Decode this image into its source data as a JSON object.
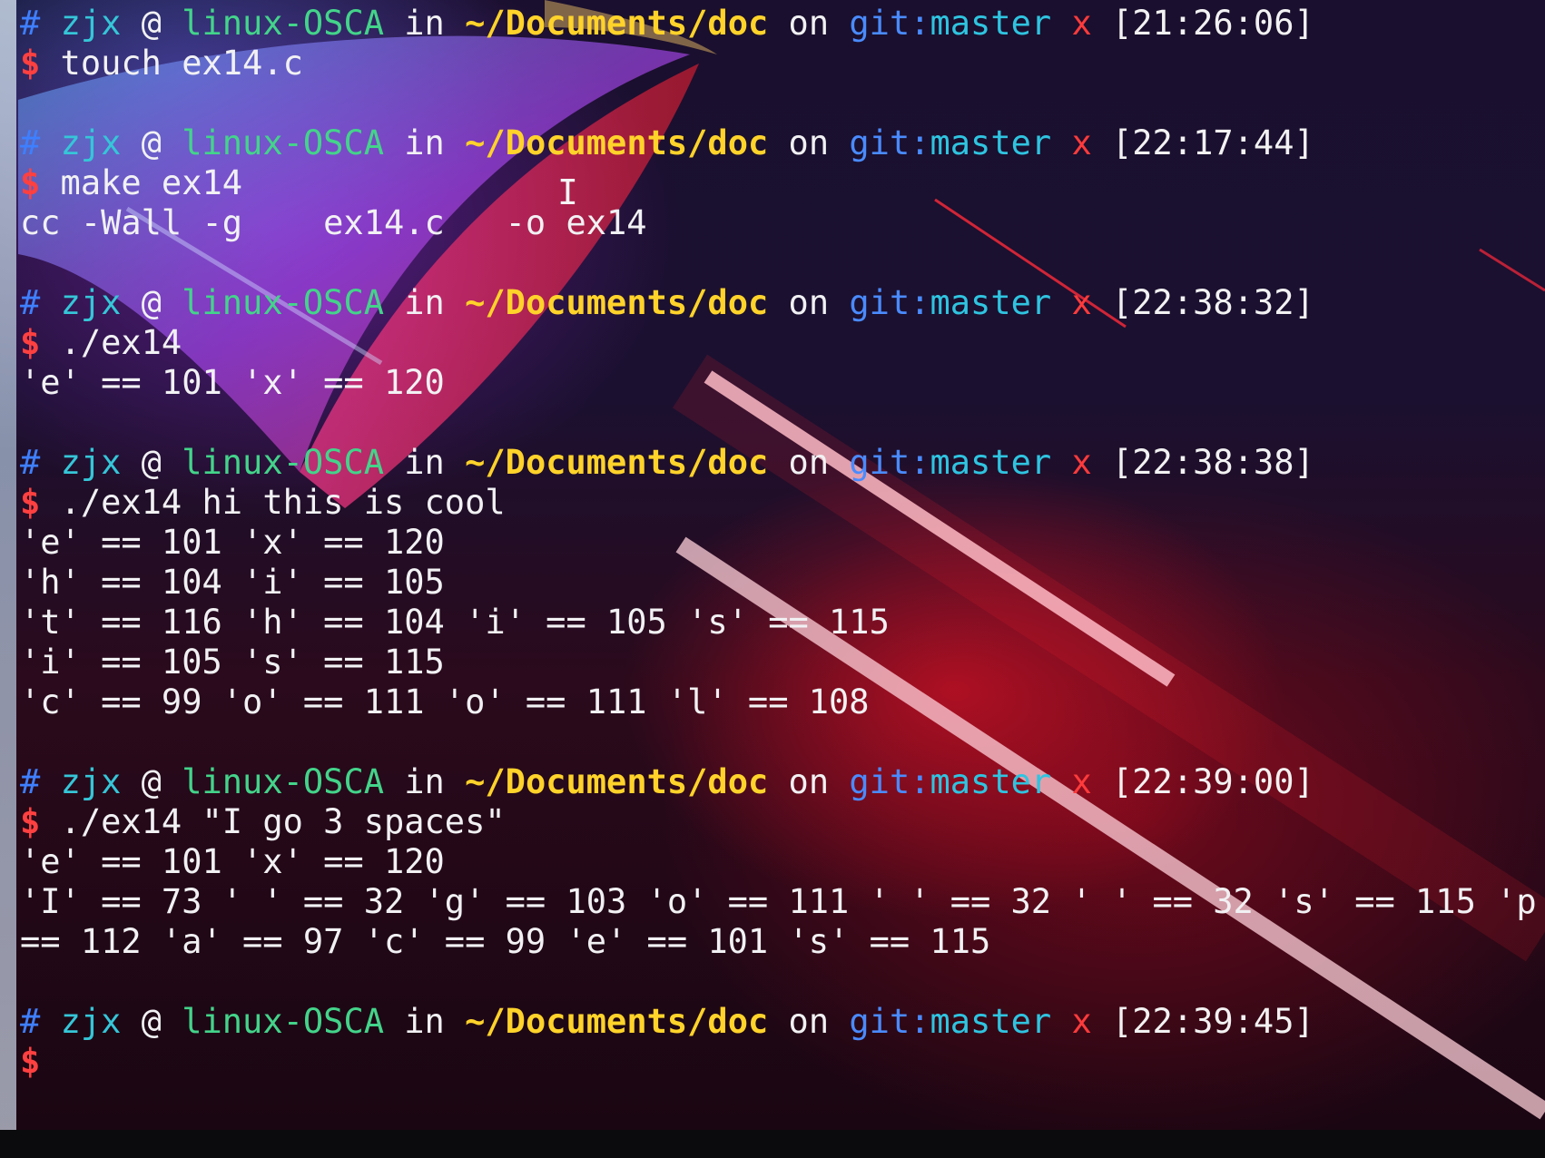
{
  "prompt_parts": {
    "hash": "#",
    "user": "zjx",
    "at": "@",
    "host": "linux-OSCA",
    "in": "in",
    "path": "~/Documents/doc",
    "on": "on",
    "git_prefix": "git:",
    "branch": "master",
    "dirty": "x",
    "dollar": "$"
  },
  "blocks": [
    {
      "timestamp": "[21:26:06]",
      "command": " touch ex14.c",
      "output": []
    },
    {
      "timestamp": "[22:17:44]",
      "command": " make ex14",
      "output": [
        "cc -Wall -g    ex14.c   -o ex14"
      ]
    },
    {
      "timestamp": "[22:38:32]",
      "command": " ./ex14",
      "output": [
        "'e' == 101 'x' == 120"
      ]
    },
    {
      "timestamp": "[22:38:38]",
      "command": " ./ex14 hi this is cool",
      "output": [
        "'e' == 101 'x' == 120",
        "'h' == 104 'i' == 105",
        "'t' == 116 'h' == 104 'i' == 105 's' == 115",
        "'i' == 105 's' == 115",
        "'c' == 99 'o' == 111 'o' == 111 'l' == 108"
      ]
    },
    {
      "timestamp": "[22:39:00]",
      "command": " ./ex14 \"I go 3 spaces\"",
      "output": [
        "'e' == 101 'x' == 120",
        "'I' == 73 ' ' == 32 'g' == 103 'o' == 111 ' ' == 32 ' ' == 32 's' == 115 'p'",
        "== 112 'a' == 97 'c' == 99 'e' == 101 's' == 115"
      ]
    },
    {
      "timestamp": "[22:39:45]",
      "command": "",
      "output": []
    }
  ],
  "cursor_glyph": "I"
}
